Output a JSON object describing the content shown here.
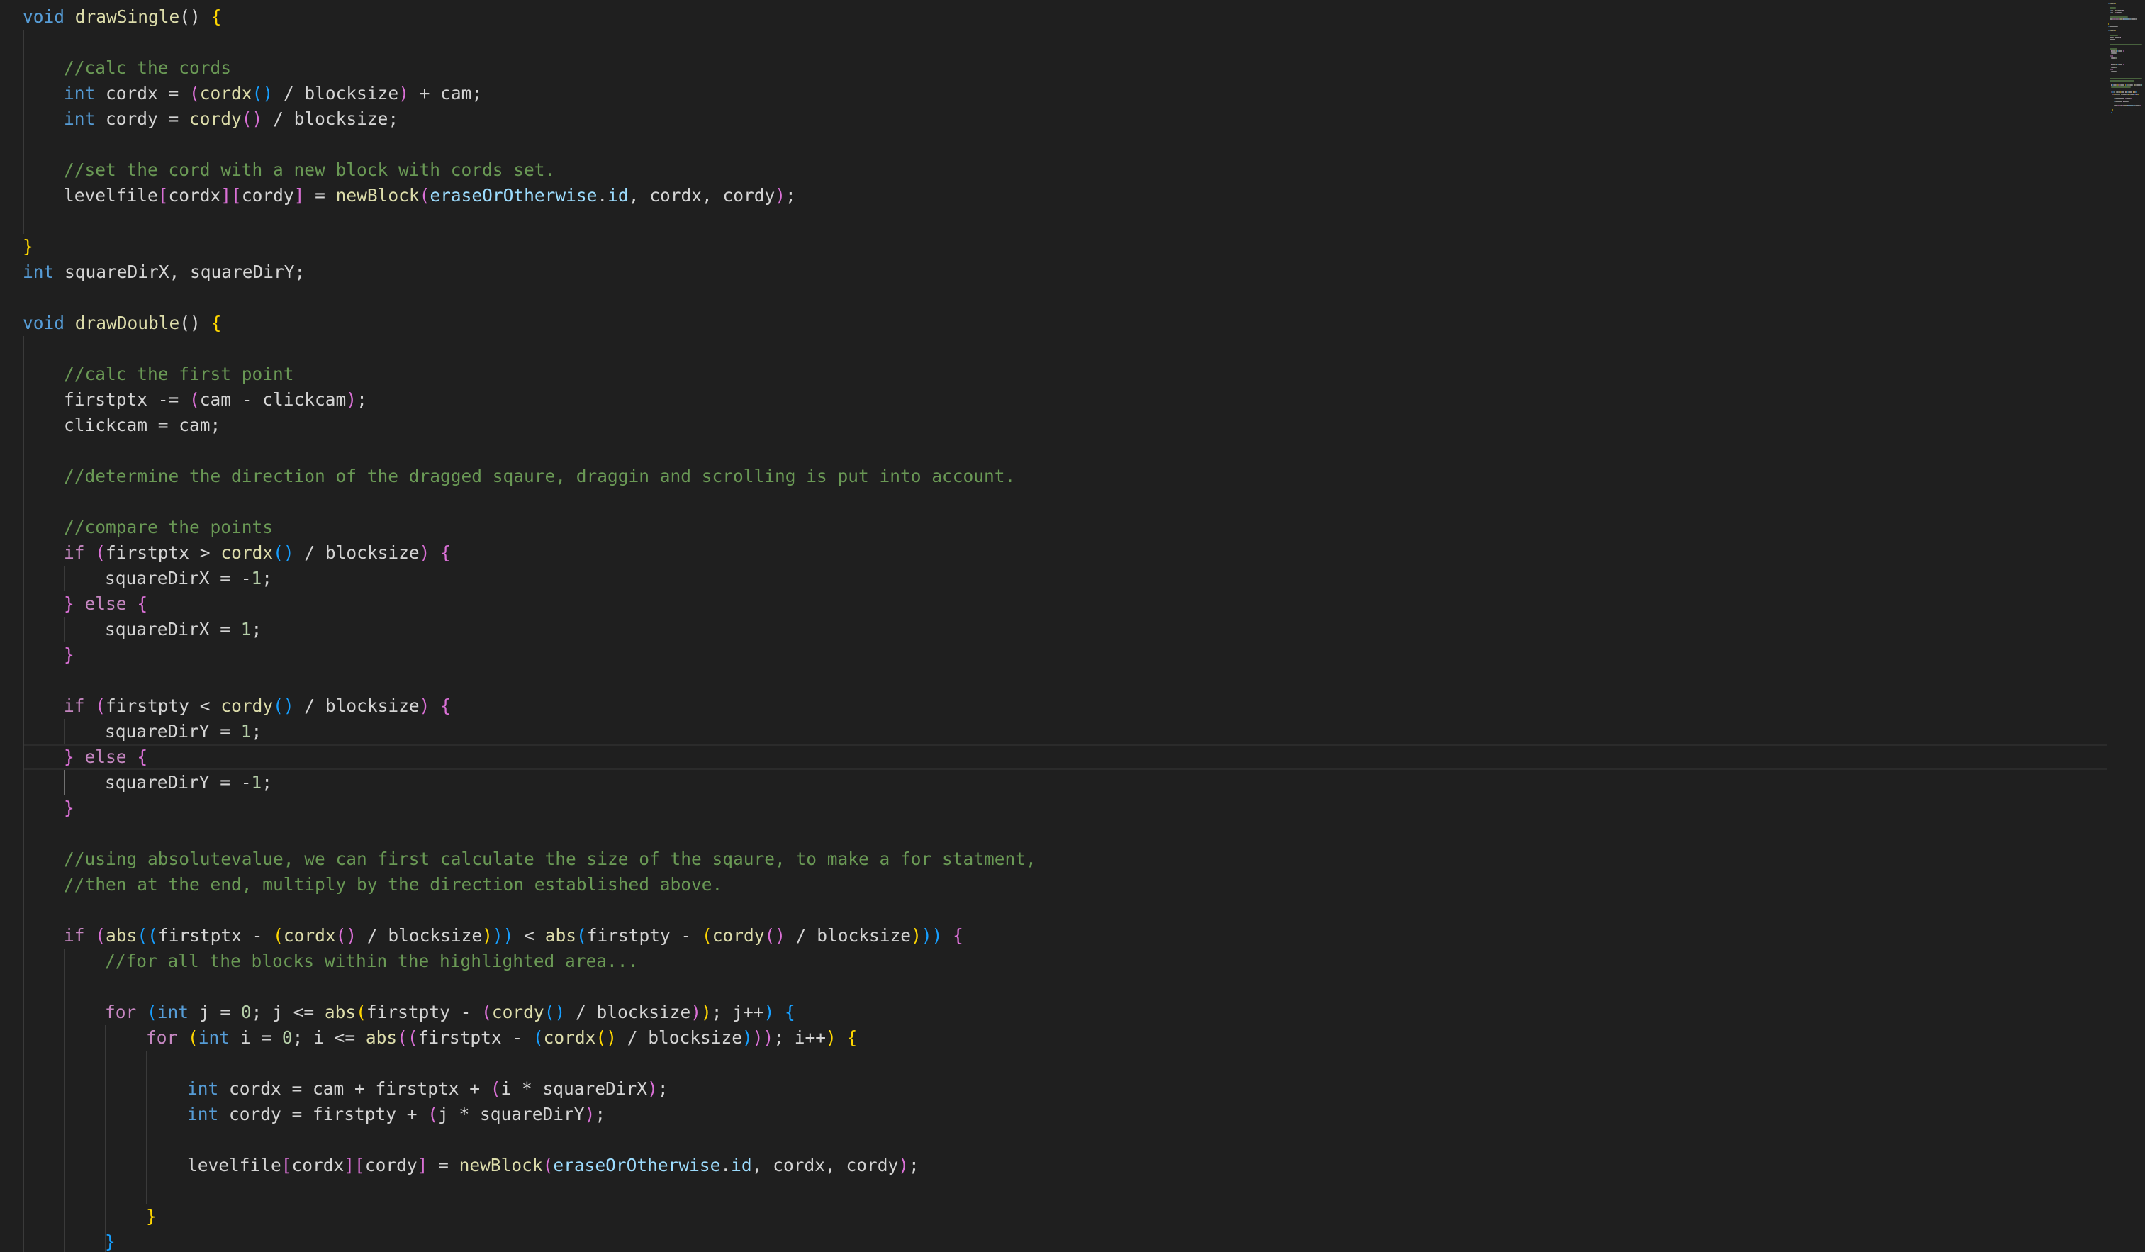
{
  "editor": {
    "lines": [
      [
        {
          "t": "void",
          "c": "kw"
        },
        {
          "t": " "
        },
        {
          "t": "drawSingle",
          "c": "fn"
        },
        {
          "t": "() "
        },
        {
          "t": "{",
          "c": "b1"
        }
      ],
      [],
      [
        {
          "t": "//calc the cords",
          "c": "cm"
        }
      ],
      [
        {
          "t": "int",
          "c": "kw"
        },
        {
          "t": " cordx = "
        },
        {
          "t": "(",
          "c": "b2"
        },
        {
          "t": "cordx",
          "c": "fn"
        },
        {
          "t": "()",
          "c": "b3"
        },
        {
          "t": " / blocksize"
        },
        {
          "t": ")",
          "c": "b2"
        },
        {
          "t": " + cam;"
        }
      ],
      [
        {
          "t": "int",
          "c": "kw"
        },
        {
          "t": " cordy = "
        },
        {
          "t": "cordy",
          "c": "fn"
        },
        {
          "t": "()",
          "c": "b2"
        },
        {
          "t": " / blocksize;"
        }
      ],
      [],
      [
        {
          "t": "//set the cord with a new block with cords set.",
          "c": "cm"
        }
      ],
      [
        {
          "t": "levelfile"
        },
        {
          "t": "[",
          "c": "b2"
        },
        {
          "t": "cordx"
        },
        {
          "t": "][",
          "c": "b2"
        },
        {
          "t": "cordy"
        },
        {
          "t": "]",
          "c": "b2"
        },
        {
          "t": " = "
        },
        {
          "t": "newBlock",
          "c": "fn"
        },
        {
          "t": "(",
          "c": "b2"
        },
        {
          "t": "eraseOrOtherwise",
          "c": "var"
        },
        {
          "t": "."
        },
        {
          "t": "id",
          "c": "var"
        },
        {
          "t": ", cordx, cordy"
        },
        {
          "t": ")",
          "c": "b2"
        },
        {
          "t": ";"
        }
      ],
      [],
      [
        {
          "t": "}",
          "c": "b1"
        }
      ],
      [
        {
          "t": "int",
          "c": "kw"
        },
        {
          "t": " squareDirX, squareDirY;"
        }
      ],
      [],
      [
        {
          "t": "void",
          "c": "kw"
        },
        {
          "t": " "
        },
        {
          "t": "drawDouble",
          "c": "fn"
        },
        {
          "t": "() "
        },
        {
          "t": "{",
          "c": "b1"
        }
      ],
      [],
      [
        {
          "t": "//calc the first point",
          "c": "cm"
        }
      ],
      [
        {
          "t": "firstptx -= "
        },
        {
          "t": "(",
          "c": "b2"
        },
        {
          "t": "cam - clickcam"
        },
        {
          "t": ")",
          "c": "b2"
        },
        {
          "t": ";"
        }
      ],
      [
        {
          "t": "clickcam = cam;"
        }
      ],
      [],
      [
        {
          "t": "//determine the direction of the dragged sqaure, draggin and scrolling is put into account.",
          "c": "cm"
        }
      ],
      [],
      [
        {
          "t": "//compare the points",
          "c": "cm"
        }
      ],
      [
        {
          "t": "if",
          "c": "ctl"
        },
        {
          "t": " "
        },
        {
          "t": "(",
          "c": "b2"
        },
        {
          "t": "firstptx > "
        },
        {
          "t": "cordx",
          "c": "fn"
        },
        {
          "t": "()",
          "c": "b3"
        },
        {
          "t": " / blocksize"
        },
        {
          "t": ")",
          "c": "b2"
        },
        {
          "t": " "
        },
        {
          "t": "{",
          "c": "b2"
        }
      ],
      [
        {
          "t": "squareDirX = -"
        },
        {
          "t": "1",
          "c": "num"
        },
        {
          "t": ";"
        }
      ],
      [
        {
          "t": "}",
          "c": "b2"
        },
        {
          "t": " "
        },
        {
          "t": "else",
          "c": "ctl"
        },
        {
          "t": " "
        },
        {
          "t": "{",
          "c": "b2"
        }
      ],
      [
        {
          "t": "squareDirX = "
        },
        {
          "t": "1",
          "c": "num"
        },
        {
          "t": ";"
        }
      ],
      [
        {
          "t": "}",
          "c": "b2"
        }
      ],
      [],
      [
        {
          "t": "if",
          "c": "ctl"
        },
        {
          "t": " "
        },
        {
          "t": "(",
          "c": "b2"
        },
        {
          "t": "firstpty < "
        },
        {
          "t": "cordy",
          "c": "fn"
        },
        {
          "t": "()",
          "c": "b3"
        },
        {
          "t": " / blocksize"
        },
        {
          "t": ")",
          "c": "b2"
        },
        {
          "t": " "
        },
        {
          "t": "{",
          "c": "b2"
        }
      ],
      [
        {
          "t": "squareDirY = "
        },
        {
          "t": "1",
          "c": "num"
        },
        {
          "t": ";"
        }
      ],
      [
        {
          "t": "}",
          "c": "b2"
        },
        {
          "t": " "
        },
        {
          "t": "else",
          "c": "ctl"
        },
        {
          "t": " "
        },
        {
          "t": "{",
          "c": "b2"
        }
      ],
      [
        {
          "t": "squareDirY = -"
        },
        {
          "t": "1",
          "c": "num"
        },
        {
          "t": ";"
        }
      ],
      [
        {
          "t": "}",
          "c": "b2"
        }
      ],
      [],
      [
        {
          "t": "//using absolutevalue, we can first calculate the size of the sqaure, to make a for statment,",
          "c": "cm"
        }
      ],
      [
        {
          "t": "//then at the end, multiply by the direction established above.",
          "c": "cm"
        }
      ],
      [],
      [
        {
          "t": "if",
          "c": "ctl"
        },
        {
          "t": " "
        },
        {
          "t": "(",
          "c": "b2"
        },
        {
          "t": "abs",
          "c": "fn"
        },
        {
          "t": "((",
          "c": "b3"
        },
        {
          "t": "firstptx - "
        },
        {
          "t": "(",
          "c": "b1"
        },
        {
          "t": "cordx",
          "c": "fn"
        },
        {
          "t": "()",
          "c": "b2"
        },
        {
          "t": " / blocksize"
        },
        {
          "t": ")",
          "c": "b1"
        },
        {
          "t": "))",
          "c": "b3"
        },
        {
          "t": " < "
        },
        {
          "t": "abs",
          "c": "fn"
        },
        {
          "t": "(",
          "c": "b3"
        },
        {
          "t": "firstpty - "
        },
        {
          "t": "(",
          "c": "b1"
        },
        {
          "t": "cordy",
          "c": "fn"
        },
        {
          "t": "()",
          "c": "b2"
        },
        {
          "t": " / blocksize"
        },
        {
          "t": ")",
          "c": "b1"
        },
        {
          "t": "))",
          "c": "b3"
        },
        {
          "t": " "
        },
        {
          "t": "{",
          "c": "b2"
        }
      ],
      [
        {
          "t": "//for all the blocks within the highlighted area...",
          "c": "cm"
        }
      ],
      [],
      [
        {
          "t": "for",
          "c": "ctl"
        },
        {
          "t": " "
        },
        {
          "t": "(",
          "c": "b3"
        },
        {
          "t": "int",
          "c": "kw"
        },
        {
          "t": " j = "
        },
        {
          "t": "0",
          "c": "num"
        },
        {
          "t": "; j <= "
        },
        {
          "t": "abs",
          "c": "fn"
        },
        {
          "t": "(",
          "c": "b1"
        },
        {
          "t": "firstpty - "
        },
        {
          "t": "(",
          "c": "b2"
        },
        {
          "t": "cordy",
          "c": "fn"
        },
        {
          "t": "()",
          "c": "b3"
        },
        {
          "t": " / blocksize"
        },
        {
          "t": ")",
          "c": "b2"
        },
        {
          "t": ")",
          "c": "b1"
        },
        {
          "t": "; j++"
        },
        {
          "t": ")",
          "c": "b3"
        },
        {
          "t": " "
        },
        {
          "t": "{",
          "c": "b3"
        }
      ],
      [
        {
          "t": "for",
          "c": "ctl"
        },
        {
          "t": " "
        },
        {
          "t": "(",
          "c": "b1"
        },
        {
          "t": "int",
          "c": "kw"
        },
        {
          "t": " i = "
        },
        {
          "t": "0",
          "c": "num"
        },
        {
          "t": "; i <= "
        },
        {
          "t": "abs",
          "c": "fn"
        },
        {
          "t": "((",
          "c": "b2"
        },
        {
          "t": "firstptx - "
        },
        {
          "t": "(",
          "c": "b3"
        },
        {
          "t": "cordx",
          "c": "fn"
        },
        {
          "t": "()",
          "c": "b1"
        },
        {
          "t": " / blocksize"
        },
        {
          "t": ")",
          "c": "b3"
        },
        {
          "t": "))",
          "c": "b2"
        },
        {
          "t": "; i++"
        },
        {
          "t": ")",
          "c": "b1"
        },
        {
          "t": " "
        },
        {
          "t": "{",
          "c": "b1"
        }
      ],
      [],
      [
        {
          "t": "int",
          "c": "kw"
        },
        {
          "t": " cordx = cam + firstptx + "
        },
        {
          "t": "(",
          "c": "b2"
        },
        {
          "t": "i * squareDirX"
        },
        {
          "t": ")",
          "c": "b2"
        },
        {
          "t": ";"
        }
      ],
      [
        {
          "t": "int",
          "c": "kw"
        },
        {
          "t": " cordy = firstpty + "
        },
        {
          "t": "(",
          "c": "b2"
        },
        {
          "t": "j * squareDirY"
        },
        {
          "t": ")",
          "c": "b2"
        },
        {
          "t": ";"
        }
      ],
      [],
      [
        {
          "t": "levelfile"
        },
        {
          "t": "[",
          "c": "b2"
        },
        {
          "t": "cordx"
        },
        {
          "t": "][",
          "c": "b2"
        },
        {
          "t": "cordy"
        },
        {
          "t": "]",
          "c": "b2"
        },
        {
          "t": " = "
        },
        {
          "t": "newBlock",
          "c": "fn"
        },
        {
          "t": "(",
          "c": "b2"
        },
        {
          "t": "eraseOrOtherwise",
          "c": "var"
        },
        {
          "t": "."
        },
        {
          "t": "id",
          "c": "var"
        },
        {
          "t": ", cordx, cordy"
        },
        {
          "t": ")",
          "c": "b2"
        },
        {
          "t": ";"
        }
      ],
      [],
      [
        {
          "t": "}",
          "c": "b1"
        }
      ],
      [
        {
          "t": "}",
          "c": "b3"
        }
      ]
    ]
  },
  "colors": {
    "background": "#1f1f1f",
    "text": "#d4d4d4",
    "keyword": "#569cd6",
    "control": "#c586c0",
    "function": "#dcdcaa",
    "variable": "#9cdcfe",
    "number": "#b5cea8",
    "comment": "#6a9955",
    "bracket_1": "#ffd700",
    "bracket_2": "#da70d6",
    "bracket_3": "#179fff"
  }
}
